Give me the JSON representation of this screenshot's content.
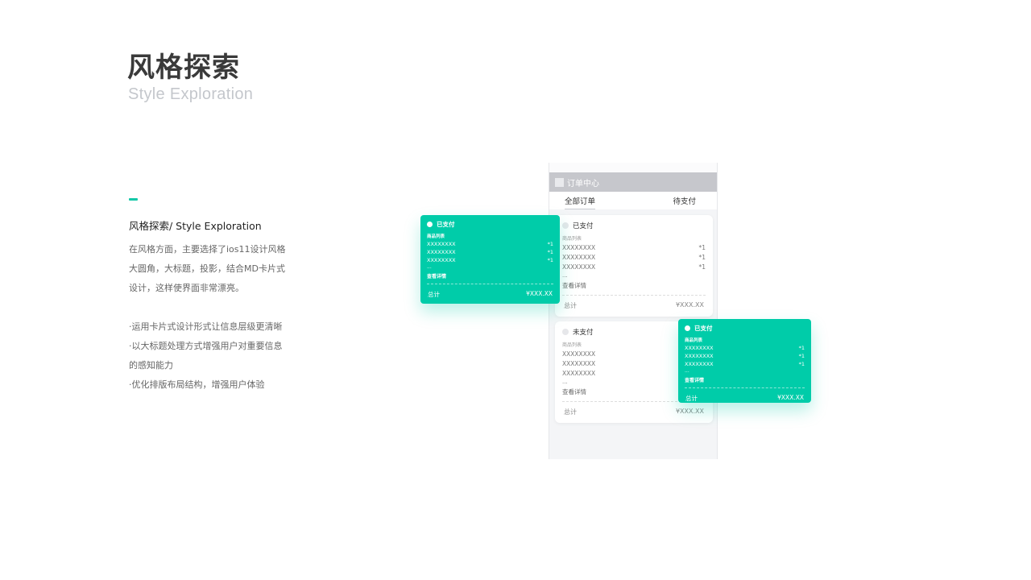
{
  "header": {
    "title": "风格探索",
    "subtitle": "Style Exploration"
  },
  "section": {
    "heading": "风格探索/ Style Exploration",
    "desc_lines": [
      "在风格方面，主要选择了ios11设计风格",
      "大圆角，大标题，投影，结合MD卡片式",
      "设计，这样使界面非常漂亮。"
    ],
    "bullets": [
      "·运用卡片式设计形式让信息层级更清晰",
      "·以大标题处理方式增强用户对重要信息",
      "的感知能力",
      "·优化排版布局结构，增强用户体验"
    ]
  },
  "phone": {
    "header_title": "订单中心",
    "tabs": [
      "全部订单",
      "待支付"
    ],
    "cards": [
      {
        "status": "已支付",
        "list_label": "商品列表",
        "items": [
          {
            "name": "XXXXXXXX",
            "qty": "*1"
          },
          {
            "name": "XXXXXXXX",
            "qty": "*1"
          },
          {
            "name": "XXXXXXXX",
            "qty": "*1"
          }
        ],
        "more": "...",
        "detail": "查看详情",
        "total_label": "总计",
        "total_value": "¥XXX.XX"
      },
      {
        "status": "未支付",
        "list_label": "商品列表",
        "items": [
          {
            "name": "XXXXXXXX",
            "qty": ""
          },
          {
            "name": "XXXXXXXX",
            "qty": ""
          },
          {
            "name": "XXXXXXXX",
            "qty": ""
          }
        ],
        "more": "...",
        "detail": "查看详情",
        "total_label": "总计",
        "total_value": "¥XXX.XX"
      }
    ]
  },
  "green_cards": [
    {
      "status": "已支付",
      "list_label": "商品列表",
      "items": [
        {
          "name": "XXXXXXXX",
          "qty": "*1"
        },
        {
          "name": "XXXXXXXX",
          "qty": "*1"
        },
        {
          "name": "XXXXXXXX",
          "qty": "*1"
        }
      ],
      "more": "...",
      "detail": "查看详情",
      "total_label": "总计",
      "total_value": "¥XXX.XX"
    },
    {
      "status": "已支付",
      "list_label": "商品列表",
      "items": [
        {
          "name": "XXXXXXXX",
          "qty": "*1"
        },
        {
          "name": "XXXXXXXX",
          "qty": "*1"
        },
        {
          "name": "XXXXXXXX",
          "qty": "*1"
        }
      ],
      "more": "...",
      "detail": "查看详情",
      "total_label": "总计",
      "total_value": "¥XXX.XX"
    }
  ],
  "colors": {
    "accent": "#00cca9",
    "header_gray": "#c6c7cc",
    "title": "#3a3a3a",
    "subtitle": "#c4c7cc"
  }
}
